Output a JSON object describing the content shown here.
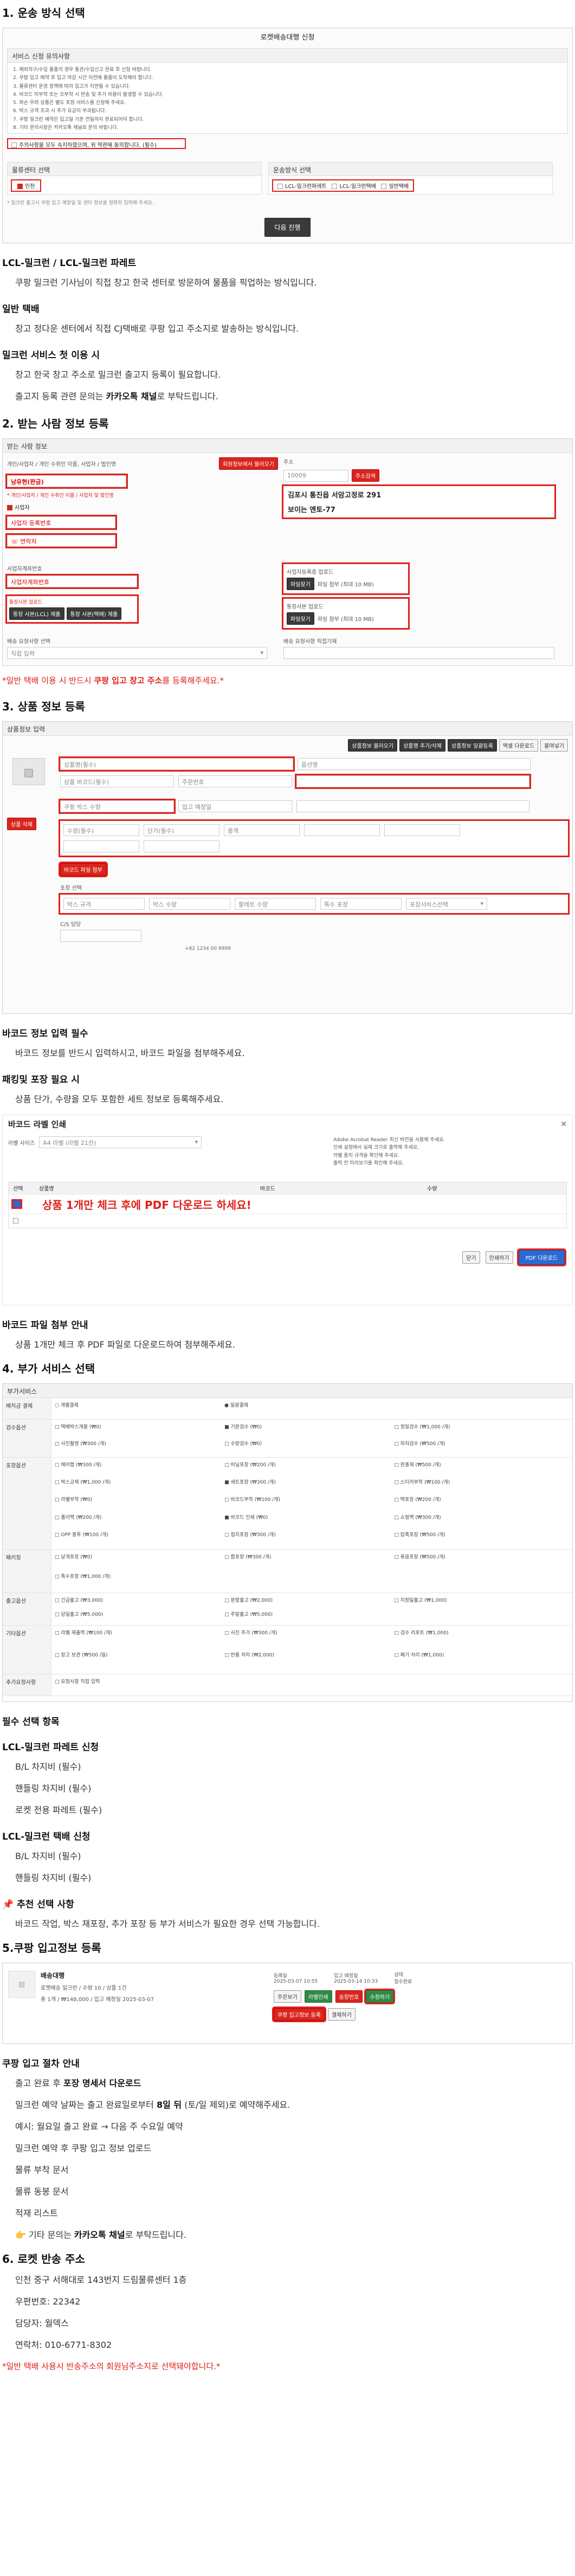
{
  "s1": {
    "title": "1. 운송 방식 선택",
    "shot": {
      "header": "로켓배송대행 신청",
      "notice_title": "서비스 신청 유의사항",
      "notice_lines": [
        "1. 해외직구/수입 물품의 경우 통관/수입신고 완료 후 신청 바랍니다.",
        "2. 쿠팡 입고 예약 후 입고 마감 시간 이전에 물품이 도착해야 합니다.",
        "3. 물류센터 운영 정책에 따라 입고가 지연될 수 있습니다.",
        "4. 바코드 미부착 또는 오부착 시 반송 및 추가 비용이 발생할 수 있습니다.",
        "5. 파손 우려 상품은 별도 포장 서비스를 신청해 주세요.",
        "6. 박스 규격 초과 시 추가 요금이 부과됩니다.",
        "7. 쿠팡 밀크런 예약은 입고일 기준 전일까지 완료되어야 합니다.",
        "8. 기타 문의사항은 카카오톡 채널로 문의 바랍니다."
      ],
      "agree_label": "주의사항을 모두 숙지하였으며, 위 약관에 동의합니다. (필수)",
      "left_title": "물류센터 선택",
      "left_value": "인천",
      "right_title": "운송방식 선택",
      "opt1": "LCL-밀크런파레트",
      "opt2": "LCL-밀크런택배",
      "opt3": "일반택배",
      "footnote": "* 밀크런 출고시 쿠팡 입고 예정일 및 센터 정보를 정확히 입력해 주세요.",
      "next_btn": "다음 진행"
    },
    "h_lcl": "LCL-밀크런 / LCL-밀크런 파레트",
    "p_lcl": "쿠팡 밀크런 기사님이 직접 창고 한국 센터로 방문하여 물품을 픽업하는 방식입니다.",
    "h_general": "일반 택배",
    "p_general": "창고 정다운 센터에서 직접 CJ택배로 쿠팡 입고 주소지로 발송하는 방식입니다.",
    "h_both": "밀크런 서비스 첫 이용 시",
    "p_both1": "창고 한국 창고 주소로 밀크런 출고지 등록이 필요합니다.",
    "p_both2_a": "출고지 등록 관련 문의는 ",
    "p_both2_b": "카카오톡 채널",
    "p_both2_c": "로 부탁드립니다."
  },
  "s2": {
    "title": "2. 받는 사람 정보 등록",
    "shot": {
      "header": "받는 사람 정보",
      "lbl_name": "개인/사업자 / 개인 수취인 이름, 사업자 / 법인명",
      "name_btn": "회원정보에서 불러오기",
      "name_value": "남유현(판금)",
      "addr_label": "주소",
      "zip": "10009",
      "zip_btn": "주소검색",
      "addr1": "김포시 통진읍 서암고정로 291",
      "addr2": "보이는 엔토-77",
      "radio_label": "사업자",
      "biz_num": "사업자 등록번호",
      "phone_label": "연락처",
      "cert_label": "사업자등록증 업로드",
      "cert_btn": "파일찾기",
      "cert_note": "파일 첨부 (최대 10 MB)",
      "account_label": "사업자계좌번호",
      "account_btn": "통장사본 업로드",
      "account_note": "파일 첨부 (최대 10 MB)",
      "delivery_label": "배송 요청사항 선택",
      "delivery_value": "직접 입력",
      "memo_label": "배송 요청사항 직접기재",
      "opt1_btn": "통장 사본(LCL) 제출",
      "opt2_btn": "통장 사본(택배) 제출"
    },
    "red_note_a": "*일반 택배 이용 시 반드시 ",
    "red_note_b": "쿠팡 입고 창고 주소",
    "red_note_c": "를 등록해주세요.*"
  },
  "s3": {
    "title": "3. 상품 정보 등록",
    "shot": {
      "header": "상품정보 입력",
      "btns": [
        "상품정보 불러오기",
        "상품행 추가/삭제",
        "상품정보 일괄등록",
        "엑셀 다운로드",
        "붙여넣기"
      ],
      "fields": [
        "상품명(필수)",
        "옵션명",
        "상품 바코드(필수)",
        "주문번호",
        "쿠팡 박스 수량",
        "입고 예정일",
        "수량(필수)",
        "단가(필수)",
        "총액"
      ],
      "del_btn": "상품 삭제",
      "barcode_btn": "바코드 파일 첨부",
      "pack_label": "포장 선택",
      "pack_fields": [
        "박스 규격",
        "박스 수량",
        "팔레트 수량",
        "특수 포장"
      ],
      "pack_select": "포장서비스선택",
      "cs_label": "C/S 담당",
      "cs_value": "+82 1234 00 9999"
    },
    "h_barcode": "바코드 정보 입력 필수",
    "p_barcode": "바코드 정보를 반드시 입력하시고, 바코드 파일을 첨부해주세요.",
    "h_packing": "패킹및 포장 필요 시",
    "p_packing": "상품 단가, 수량을 모두 포함한 세트 정보로 등록해주세요.",
    "label_title": "바코드 라벨 인쇄",
    "label_shot": {
      "print_label": "라벨 사이즈",
      "print_value": "A4 라벨 (라벨 21칸)",
      "notes": [
        "Adobe Acrobat Reader 최신 버전을 사용해 주세요.",
        "인쇄 설정에서 실제 크기로 출력해 주세요.",
        "라벨 용지 규격을 확인해 주세요.",
        "출력 전 미리보기를 확인해 주세요."
      ],
      "col1": "선택",
      "col2": "상품명",
      "col3": "바코드",
      "col4": "수량",
      "big": "상품 1개만 체크 후에 PDF 다운로드 하세요!",
      "btn1": "닫기",
      "btn2": "인쇄하기",
      "btn3": "PDF 다운로드"
    },
    "h_barcode_file": "바코드 파일 첨부 안내",
    "p_barcode_file": "상품 1개만 체크 후 PDF 파일로 다운로드하여 첨부해주세요."
  },
  "s4": {
    "title": "4. 부가 서비스 선택",
    "shot": {
      "header": "부가서비스",
      "rows": [
        {
          "hd": "배치금 결제",
          "cells": [
            "○ 개별결제",
            "● 일괄결제"
          ]
        },
        {
          "hd": "검수옵션",
          "cells": [
            "□ 택배박스개봉 (₩0)",
            "■ 기본검수 (₩0)",
            "□ 정밀검수 (₩1,000 /개)",
            "□ 사진촬영 (₩300 /개)",
            "□ 수량검수 (₩0)",
            "□ 하자검수 (₩500 /개)"
          ]
        },
        {
          "hd": "포장옵션",
          "cells": [
            "□ 에어캡 (₩300 /개)",
            "□ 비닐포장 (₩200 /개)",
            "□ 완충재 (₩500 /개)",
            "□ 박스교체 (₩1,000 /개)",
            "■ 세트포장 (₩300 /개)",
            "□ 스티커부착 (₩100 /개)",
            "□ 라벨부착 (₩0)",
            "□ 바코드부착 (₩100 /개)",
            "□ 택포장 (₩200 /개)",
            "□ 폴리백 (₩200 /개)",
            "■ 바코드 인쇄 (₩0)",
            "□ 쇼핑백 (₩300 /개)",
            "□ OPP 봉투 (₩100 /개)",
            "□ 접지포장 (₩300 /개)",
            "□ 압축포장 (₩500 /개)"
          ]
        },
        {
          "hd": "패키징",
          "cells": [
            "□ 낱개포장 (₩0)",
            "□ 합포장 (₩300 /개)",
            "□ 묶음포장 (₩500 /개)",
            "□ 특수포장 (₩1,000 /개)"
          ]
        },
        {
          "hd": "출고옵션",
          "cells": [
            "□ 긴급출고 (₩3,000)",
            "□ 분할출고 (₩2,000)",
            "□ 지정일출고 (₩1,000)",
            "□ 당일출고 (₩5,000)",
            "□ 주말출고 (₩5,000)"
          ]
        },
        {
          "hd": "기타옵션",
          "cells": [
            "□ 라벨 재출력 (₩100 /개)",
            "□ 사진 추가 (₩300 /개)",
            "□ 검수 리포트 (₩1,000)",
            "□ 창고 보관 (₩500 /일)",
            "□ 반품 처리 (₩2,000)",
            "□ 폐기 처리 (₩1,000)"
          ]
        },
        {
          "hd": "추가요청사항",
          "cells": [
            "□ 요청사항 직접 입력"
          ]
        }
      ]
    },
    "h_required": "필수 선택 항목",
    "h_pallet": "LCL-밀크런 파레트 신청",
    "pallet_items": [
      "B/L 차지비 (필수)",
      "핸들링 차지비 (필수)",
      "로켓 전용 파레트 (필수)"
    ],
    "h_parcel": "LCL-밀크런 택배 신청",
    "parcel_items": [
      "B/L 차지비 (필수)",
      "핸들링 차지비 (필수)"
    ],
    "h_recommend": "추천 선택 사항",
    "p_recommend": "바코드 작업, 박스 재포장, 추가 포장 등 부가 서비스가 필요한 경우 선택 가능합니다."
  },
  "s5": {
    "title": "5.쿠팡 입고정보 등록",
    "shot": {
      "name": "배송대행",
      "sub": "로켓배송 밀크런 / 수량 10 / 상품 1건",
      "detail": "총 1개 / ₩148,000 / 입고 예정일 2025-03-07",
      "date_label": "등록일",
      "date_value": "2025-03-07 10:55",
      "date2_label": "입고 예정일",
      "date2_value": "2025-03-14 10:33",
      "status_label": "상태",
      "status_value": "접수완료",
      "btn_a": "주문보기",
      "btn_b": "라벨인쇄",
      "btn_c": "쿠팡 입고정보 등록",
      "btn_d": "송장번호",
      "btn_e": "수정하기",
      "btn_f": "결제하기"
    },
    "h_flow": "쿠팡 입고 절차 안내",
    "p_flow1_a": "출고 완료 후 ",
    "p_flow1_b": "포장 명세서 다운로드",
    "p_flow2_a": "밀크런 예약 날짜는 출고 완료일로부터 ",
    "p_flow2_b": "8일 뒤",
    "p_flow2_c": " (토/일 제외)로 예약해주세요.",
    "p_flow3": "예시: 월요일 출고 완료 → 다음 주 수요일 예약",
    "p_flow4": "밀크런 예약 후 쿠팡 입고 정보 업로드",
    "docs": [
      "물류 부착 문서",
      "물류 동봉 문서",
      "적재 리스트"
    ],
    "p_flow5_a": "기타 문의는 ",
    "p_flow5_b": "카카오톡 채널",
    "p_flow5_c": "로 부탁드립니다."
  },
  "s6": {
    "title": "6. 로켓 반송 주소",
    "addr": "인천 중구 서해대로 143번지 드림물류센터 1층",
    "zip": "우편번호: 22342",
    "manager": "담당자: 월덱스",
    "phone": "연락처: 010-6771-8302",
    "red_note": "*일반 택배 사용시 반송주소의 회원님주소지로 선택돼야합니다.*"
  },
  "colors": {
    "red": "#e0201b",
    "blue": "#2b6ad1",
    "green": "#2e8b46"
  }
}
